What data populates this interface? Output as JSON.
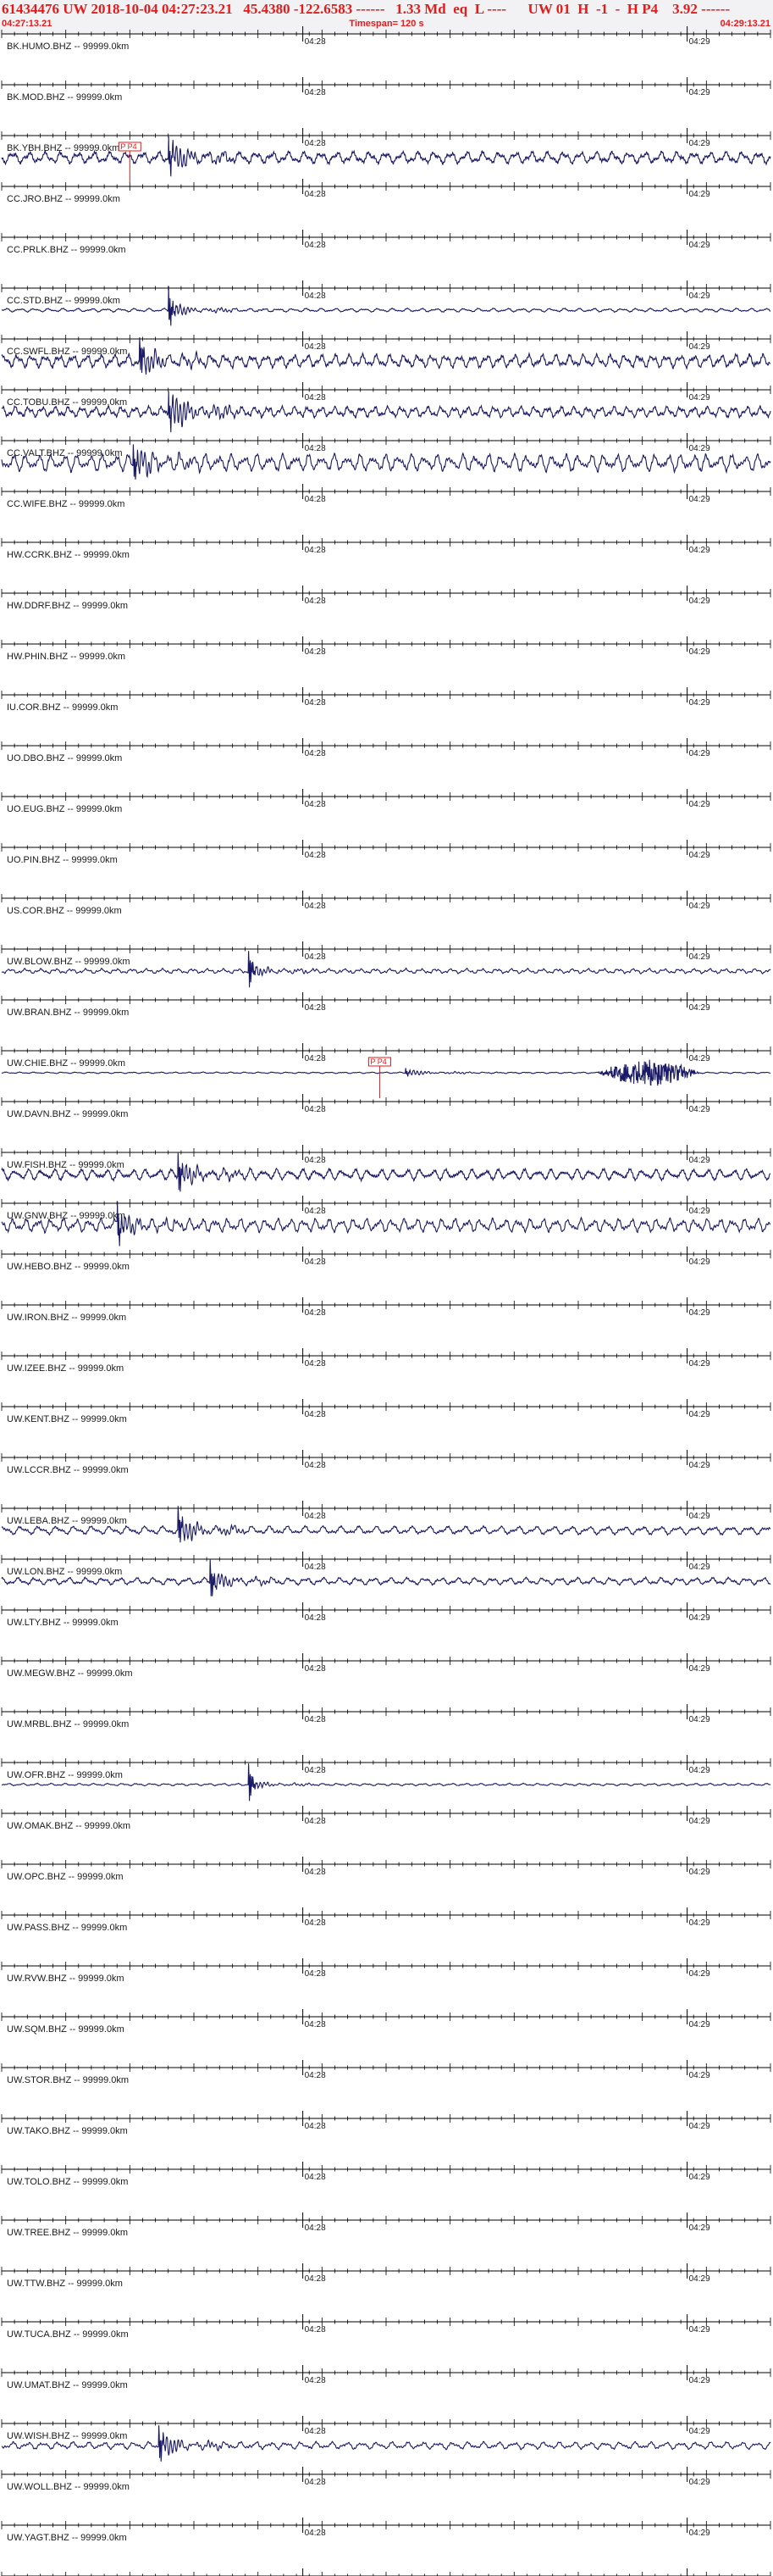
{
  "header": {
    "line1": "61434476 UW 2018-10-04 04:27:23.21   45.4380 -122.6583 ------   1.33 Md  eq  L ----      UW 01  H  -1  -  H P4    3.92 ------",
    "start_time": "04:27:13.21",
    "timespan": "Timespan= 120 s",
    "end_time": "04:29:13.21"
  },
  "colors": {
    "header_text": "#e41b1b",
    "header_bg": "#f2f2f4",
    "trace": "#1a1a66",
    "axis": "#000000",
    "pick": "#e41b1b",
    "label": "#1a1a1a"
  },
  "chart_data": {
    "type": "line",
    "x_axis": {
      "unit": "s",
      "range": [
        0,
        120
      ],
      "tick_major_every_s": 10,
      "tick_minor_every_s": 2,
      "time_labels": [
        {
          "t": 47,
          "text": "04:28"
        },
        {
          "t": 107,
          "text": "04:29"
        }
      ]
    },
    "stations": [
      {
        "label": "BK.HUMO.BHZ -- 99999.0km",
        "active": false
      },
      {
        "label": "BK.MOD.BHZ -- 99999.0km",
        "active": false
      },
      {
        "label": "BK.YBH.BHZ -- 99999.0km",
        "active": true,
        "onset": 26.0,
        "noise": 0.5,
        "spike": 1.2,
        "coda": 0.9,
        "pick": {
          "t": 20,
          "text": "P P4"
        }
      },
      {
        "label": "CC.JRO.BHZ -- 99999.0km",
        "active": false
      },
      {
        "label": "CC.PRLK.BHZ -- 99999.0km",
        "active": false
      },
      {
        "label": "CC.STD.BHZ -- 99999.0km",
        "active": true,
        "onset": 26.0,
        "noise": 0.15,
        "spike": 1.5,
        "coda": 0.45
      },
      {
        "label": "CC.SWFL.BHZ -- 99999.0km",
        "active": true,
        "onset": 21.5,
        "noise": 0.55,
        "spike": 1.5,
        "coda": 0.8
      },
      {
        "label": "CC.TOBU.BHZ -- 99999.0km",
        "active": true,
        "onset": 26.0,
        "noise": 0.45,
        "spike": 1.1,
        "coda": 1.2
      },
      {
        "label": "CC.VALT.BHZ -- 99999.0km",
        "active": true,
        "onset": 20.5,
        "noise": 0.7,
        "spike": 1.3,
        "coda": 0.9
      },
      {
        "label": "CC.WIFE.BHZ -- 99999.0km",
        "active": false
      },
      {
        "label": "HW.CCRK.BHZ -- 99999.0km",
        "active": false
      },
      {
        "label": "HW.DDRF.BHZ -- 99999.0km",
        "active": false
      },
      {
        "label": "HW.PHIN.BHZ -- 99999.0km",
        "active": false
      },
      {
        "label": "IU.COR.BHZ -- 99999.0km",
        "active": false
      },
      {
        "label": "UO.DBO.BHZ -- 99999.0km",
        "active": false
      },
      {
        "label": "UO.EUG.BHZ -- 99999.0km",
        "active": false
      },
      {
        "label": "UO.PIN.BHZ -- 99999.0km",
        "active": false
      },
      {
        "label": "US.COR.BHZ -- 99999.0km",
        "active": false
      },
      {
        "label": "UW.BLOW.BHZ -- 99999.0km",
        "active": true,
        "onset": 38.5,
        "noise": 0.2,
        "spike": 1.5,
        "coda": 0.35
      },
      {
        "label": "UW.BRAN.BHZ -- 99999.0km",
        "active": false
      },
      {
        "label": "UW.CHIE.BHZ -- 99999.0km",
        "active": true,
        "onset": 63.0,
        "noise": 0.06,
        "spike": 0.25,
        "coda": 0.2,
        "burst": {
          "t0": 93,
          "t1": 109,
          "amp": 1.1
        },
        "pick": {
          "t": 59,
          "text": "P P4"
        }
      },
      {
        "label": "UW.DAVN.BHZ -- 99999.0km",
        "active": false
      },
      {
        "label": "UW.FISH.BHZ -- 99999.0km",
        "active": true,
        "onset": 27.5,
        "noise": 0.45,
        "spike": 1.5,
        "coda": 0.7
      },
      {
        "label": "UW.GNW.BHZ -- 99999.0km",
        "active": true,
        "onset": 18.0,
        "noise": 0.55,
        "spike": 1.4,
        "coda": 0.7
      },
      {
        "label": "UW.HEBO.BHZ -- 99999.0km",
        "active": false
      },
      {
        "label": "UW.IRON.BHZ -- 99999.0km",
        "active": false
      },
      {
        "label": "UW.IZEE.BHZ -- 99999.0km",
        "active": false
      },
      {
        "label": "UW.KENT.BHZ -- 99999.0km",
        "active": false
      },
      {
        "label": "UW.LCCR.BHZ -- 99999.0km",
        "active": false
      },
      {
        "label": "UW.LEBA.BHZ -- 99999.0km",
        "active": true,
        "onset": 27.5,
        "noise": 0.35,
        "spike": 1.4,
        "coda": 0.8
      },
      {
        "label": "UW.LON.BHZ -- 99999.0km",
        "active": true,
        "onset": 32.5,
        "noise": 0.3,
        "spike": 1.5,
        "coda": 0.55
      },
      {
        "label": "UW.LTY.BHZ -- 99999.0km",
        "active": false
      },
      {
        "label": "UW.MEGW.BHZ -- 99999.0km",
        "active": false
      },
      {
        "label": "UW.MRBL.BHZ -- 99999.0km",
        "active": false
      },
      {
        "label": "UW.OFR.BHZ -- 99999.0km",
        "active": true,
        "onset": 38.5,
        "noise": 0.1,
        "spike": 1.5,
        "coda": 0.25
      },
      {
        "label": "UW.OMAK.BHZ -- 99999.0km",
        "active": false
      },
      {
        "label": "UW.OPC.BHZ -- 99999.0km",
        "active": false
      },
      {
        "label": "UW.PASS.BHZ -- 99999.0km",
        "active": false
      },
      {
        "label": "UW.RVW.BHZ -- 99999.0km",
        "active": false
      },
      {
        "label": "UW.SQM.BHZ -- 99999.0km",
        "active": false
      },
      {
        "label": "UW.STOR.BHZ -- 99999.0km",
        "active": false
      },
      {
        "label": "UW.TAKO.BHZ -- 99999.0km",
        "active": false
      },
      {
        "label": "UW.TOLO.BHZ -- 99999.0km",
        "active": false
      },
      {
        "label": "UW.TREE.BHZ -- 99999.0km",
        "active": false
      },
      {
        "label": "UW.TTW.BHZ -- 99999.0km",
        "active": false
      },
      {
        "label": "UW.TUCA.BHZ -- 99999.0km",
        "active": false
      },
      {
        "label": "UW.UMAT.BHZ -- 99999.0km",
        "active": false
      },
      {
        "label": "UW.WISH.BHZ -- 99999.0km",
        "active": true,
        "onset": 24.5,
        "noise": 0.3,
        "spike": 1.3,
        "coda": 0.75
      },
      {
        "label": "UW.WOLL.BHZ -- 99999.0km",
        "active": false
      },
      {
        "label": "UW.YAGT.BHZ -- 99999.0km",
        "active": false
      }
    ]
  }
}
